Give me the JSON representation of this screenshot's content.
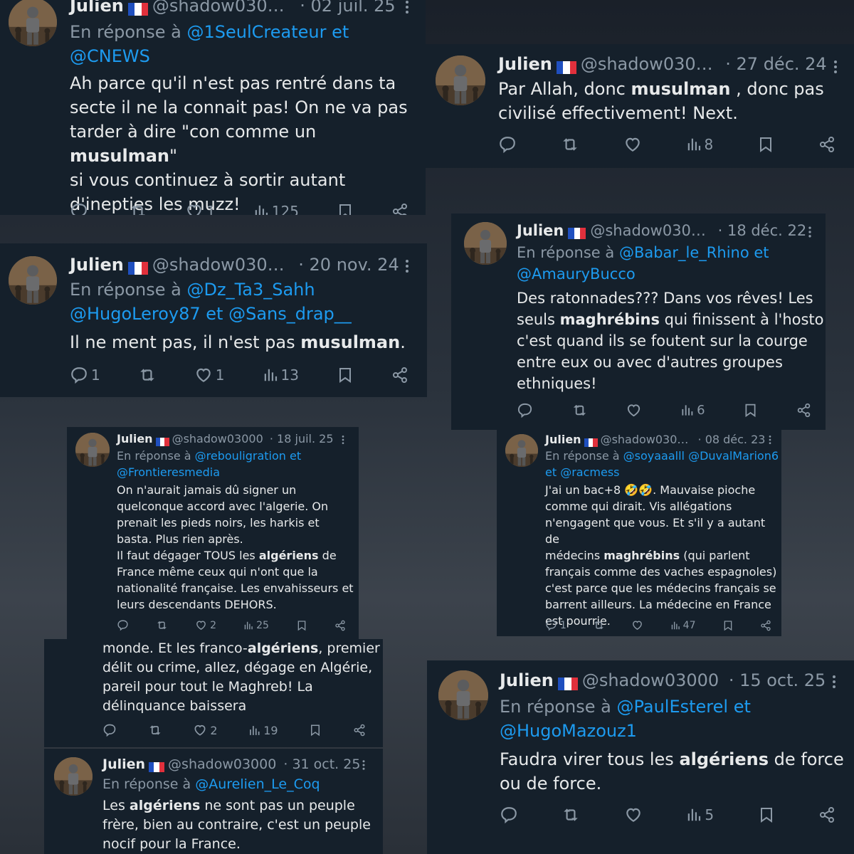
{
  "colors": {
    "card_bg": "#15202b",
    "text": "#e7e9ea",
    "muted": "#8b98a5",
    "mention": "#1d9bf0"
  },
  "tweets": [
    {
      "name": "Julien",
      "flag": "flag-france-icon",
      "handle": "@shadow030…",
      "date": "· 02 juil. 25",
      "reply_prefix": "En réponse à",
      "reply_line1": "@1SeulCreateur et",
      "reply_line2": "@CNEWS",
      "lines": [
        "Ah parce qu'il n'est pas rentré dans ta",
        "secte il ne la connait pas! On ne va pas",
        "tarder à dire \"con comme un ",
        "musulman",
        "\"",
        "si vous continuez à sortir autant",
        "d'inepties les muzz!"
      ],
      "text_1": "Ah parce qu'il n'est pas rentré dans ta",
      "text_2": "secte il ne la connait pas! On ne va pas",
      "text_3a": "tarder à dire \"con comme un ",
      "text_3b": "musulman",
      "text_3c": "\"",
      "text_4": "si vous continuez à sortir autant",
      "text_5": "d'inepties les muzz!",
      "replies": "",
      "likes": "1",
      "views": "125"
    },
    {
      "name": "Julien",
      "flag": "flag-france-icon",
      "handle": "@shadow030…",
      "date": "· 27 déc. 24",
      "text_1a": "Par Allah, donc ",
      "text_1b": "musulman",
      "text_1c": " , donc pas",
      "text_2": "civilisé effectivement! Next.",
      "replies": "",
      "likes": "",
      "views": "8"
    },
    {
      "name": "Julien",
      "flag": "flag-france-icon",
      "handle": "@shadow030…",
      "date": "· 20 nov. 24",
      "reply_prefix": "En réponse à",
      "reply_line1": "@Dz_Ta3_Sahh",
      "reply_line2a": "@HugoLeroy87",
      "reply_line2b": " et ",
      "reply_line2c": "@Sans_drap__",
      "text_1a": "Il ne ment pas, il n'est pas ",
      "text_1b": "musulman",
      "text_1c": ".",
      "replies": "1",
      "likes": "1",
      "views": "13"
    },
    {
      "name": "Julien",
      "flag": "flag-france-icon",
      "handle": "@shadow030…",
      "date": "· 18 déc. 22",
      "reply_prefix": "En réponse à",
      "reply_line1": "@Babar_le_Rhino et",
      "reply_line2": "@AmauryBucco",
      "text_1": "Des ratonnades??? Dans vos rêves! Les",
      "text_2a": "seuls ",
      "text_2b": "maghrébins",
      "text_2c": " qui finissent à l'hosto",
      "text_3": "c'est quand ils se foutent sur la courge",
      "text_4": "entre eux ou avec d'autres groupes",
      "text_5": "ethniques!",
      "replies": "",
      "likes": "",
      "views": "6"
    },
    {
      "name": "Julien",
      "flag": "flag-france-icon",
      "handle": "@shadow03000",
      "date": "· 18 juil. 25",
      "reply_prefix": "En réponse à",
      "reply_line1": "@rebouligration et",
      "reply_line2": "@Frontieresmedia",
      "text_1": "On n'aurait jamais dû signer un",
      "text_2": "quelconque accord avec l'algerie. On",
      "text_3": "prenait les pieds noirs, les harkis et",
      "text_4": "basta. Plus rien après.",
      "text_5a": "Il faut dégager TOUS les ",
      "text_5b": "algériens",
      "text_5c": " de",
      "text_6": "France même ceux qui n'ont que la",
      "text_7": "nationalité française. Les envahisseurs et",
      "text_8": "leurs descendants DEHORS.",
      "replies": "",
      "likes": "2",
      "views": "25"
    },
    {
      "name": "Julien",
      "flag": "flag-france-icon",
      "handle": "@shadow030…",
      "date": "· 08 déc. 23",
      "reply_prefix": "En réponse à",
      "reply_line1": "@soyaaalll @DuvalMarion6",
      "reply_line2": "et @racmess",
      "text_1": "J'ai un bac+8 🤣🤣. Mauvaise pioche",
      "text_2": "comme qui dirait. Vis allégations",
      "text_3": "n'engagent que vous. Et s'il y a autant de",
      "text_4a": "médecins ",
      "text_4b": "maghrébins",
      "text_4c": " (qui parlent",
      "text_5": "français comme des vaches espagnoles)",
      "text_6": "c'est parce que les médecins français se",
      "text_7": "barrent ailleurs. La médecine en France",
      "text_8": "est pourrie.",
      "replies": "1",
      "likes": "",
      "views": "47"
    },
    {
      "text_1a": "monde. Et les franco-",
      "text_1b": "algériens",
      "text_1c": ", premier",
      "text_2": "délit ou crime, allez, dégage en Algérie,",
      "text_3": "pareil pour tout le Maghreb! La",
      "text_4": "délinquance baissera",
      "replies": "",
      "likes": "2",
      "views": "19"
    },
    {
      "name": "Julien",
      "flag": "flag-france-icon",
      "handle": "@shadow03000",
      "date": "· 15 oct. 25",
      "reply_prefix": "En réponse à",
      "reply_line1": "@PaulEsterel et",
      "reply_line2": "@HugoMazouz1",
      "text_1a": "Faudra virer tous les ",
      "text_1b": "algériens",
      "text_1c": " de force",
      "text_2": "ou de force.",
      "replies": "",
      "likes": "",
      "views": "5"
    },
    {
      "name": "Julien",
      "flag": "flag-france-icon",
      "handle": "@shadow03000",
      "date": "· 31 oct. 25",
      "reply_prefix": "En réponse à",
      "reply_line1": "@Aurelien_Le_Coq",
      "text_1a": "Les ",
      "text_1b": "algériens",
      "text_1c": " ne sont pas un peuple",
      "text_2": "frère, bien au contraire, c'est un peuple",
      "text_3": "nocif pour la France."
    }
  ]
}
